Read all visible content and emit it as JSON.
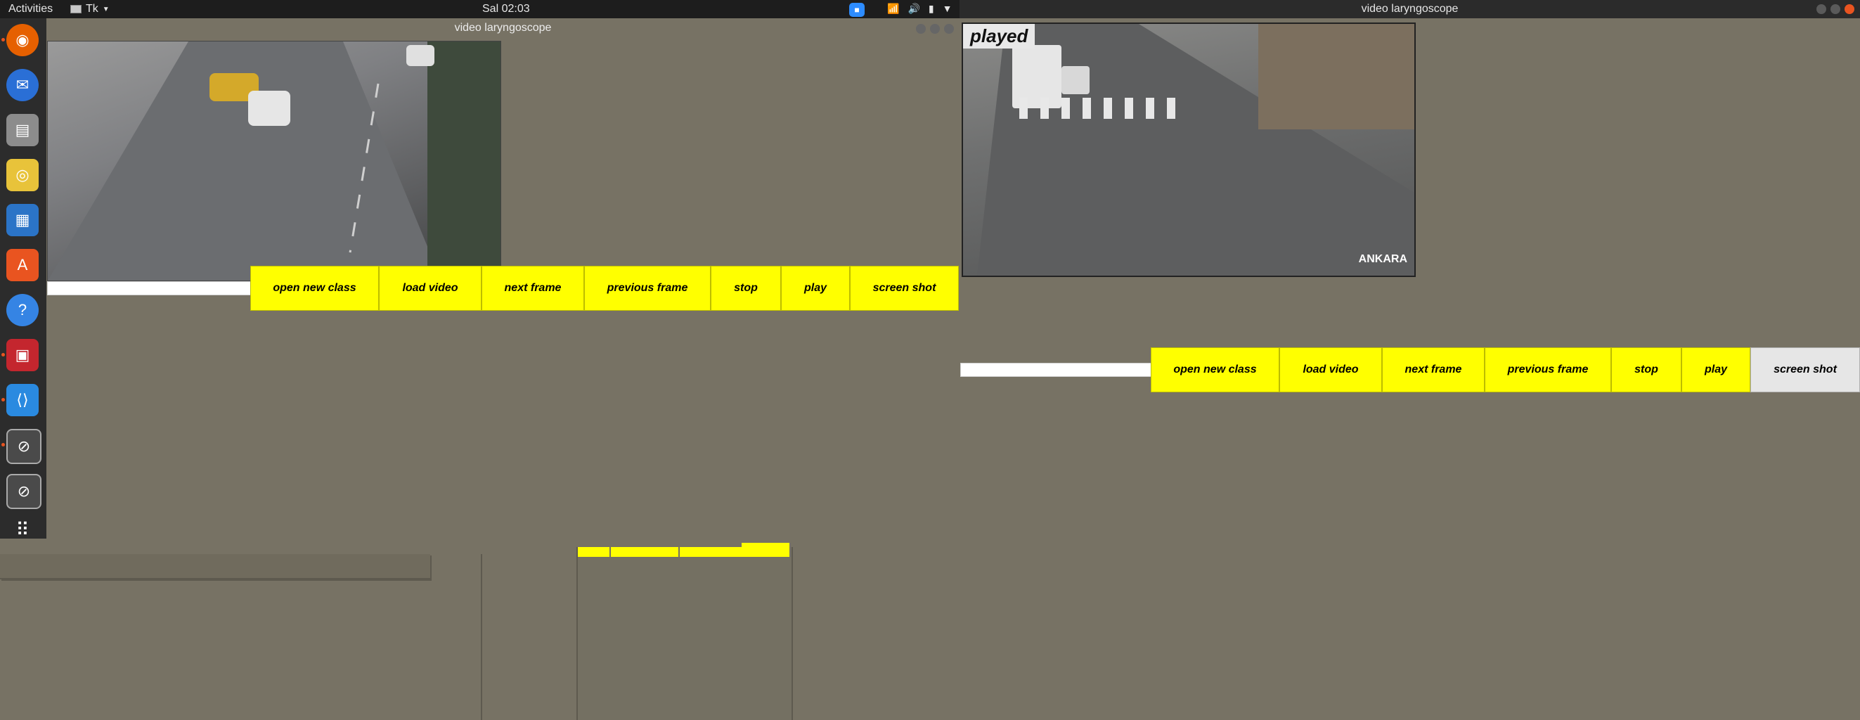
{
  "topbar": {
    "activities": "Activities",
    "app_menu": "Tk",
    "clock": "Sal 02:03"
  },
  "icons": {
    "app_menu_flag": "flag-icon",
    "app_menu_caret": "chevron-down-icon",
    "zoom": "zoom-icon",
    "network": "network-icon",
    "volume": "volume-icon",
    "battery": "battery-icon",
    "system_menu": "chevron-down-icon"
  },
  "dock": {
    "items": [
      {
        "name": "firefox-icon",
        "color": "#e66000"
      },
      {
        "name": "thunderbird-icon",
        "color": "#2a6fd6"
      },
      {
        "name": "files-icon",
        "color": "#8c8c8c"
      },
      {
        "name": "rhythmbox-icon",
        "color": "#e8c33a"
      },
      {
        "name": "writer-icon",
        "color": "#2b74c7"
      },
      {
        "name": "software-icon",
        "color": "#e95420"
      },
      {
        "name": "help-icon",
        "color": "#3584e4"
      },
      {
        "name": "presentation-icon",
        "color": "#c4262e"
      },
      {
        "name": "vscode-icon",
        "color": "#2a8ae0"
      },
      {
        "name": "tk-window-icon",
        "color": "#4a4a4a"
      },
      {
        "name": "tk-window-icon",
        "color": "#4a4a4a"
      }
    ],
    "show_apps": "app-grid-icon"
  },
  "left_window": {
    "title": "video laryngoscope",
    "entry_value": "",
    "buttons": [
      "open new class",
      "load video",
      "next frame",
      "previous frame",
      "stop",
      "play",
      "screen shot"
    ]
  },
  "right_window": {
    "title": "video laryngoscope",
    "status_label": "played",
    "video_overlay_text": "ANKARA",
    "entry_value": "",
    "buttons": [
      "open new class",
      "load video",
      "next frame",
      "previous frame",
      "stop",
      "play",
      "screen shot"
    ]
  },
  "colors": {
    "desktop_bg": "#777264",
    "button_yellow": "#ffff00",
    "button_active_grey": "#e6e6e6",
    "accent_orange": "#e95420"
  }
}
